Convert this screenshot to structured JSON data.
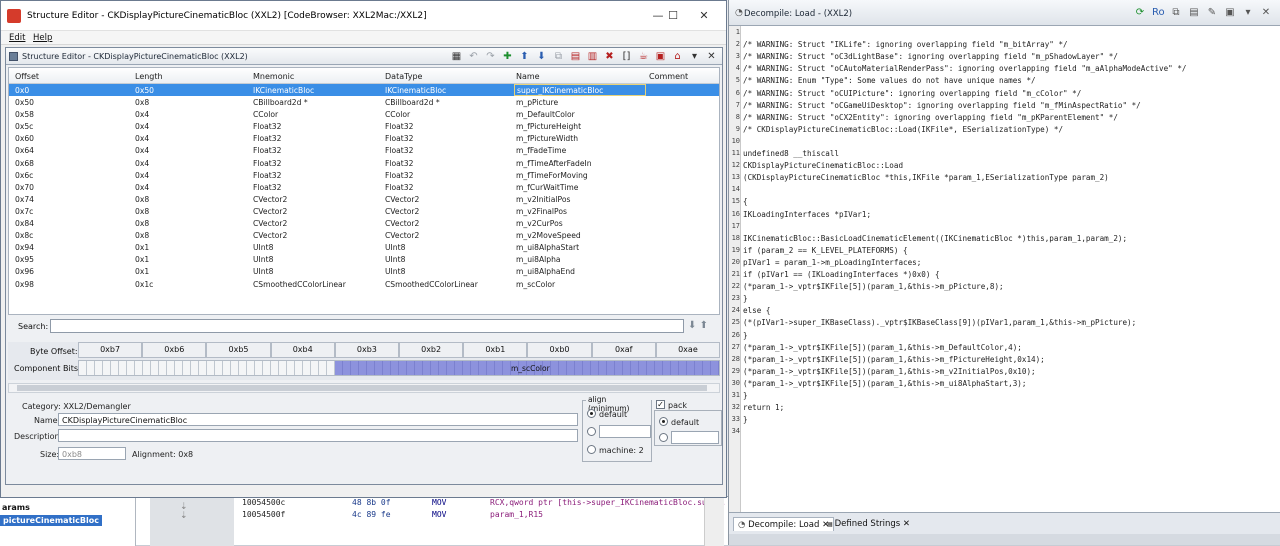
{
  "window": {
    "title": "Structure Editor - CKDisplayPictureCinematicBloc (XXL2) [CodeBrowser: XXL2Mac:/XXL2]",
    "minimize": "—",
    "maximize": "☐",
    "close": "✕"
  },
  "menu": [
    "Edit",
    "Help"
  ],
  "editor": {
    "title": "Structure Editor - CKDisplayPictureCinematicBloc (XXL2)",
    "columns": [
      "Offset",
      "Length",
      "Mnemonic",
      "DataType",
      "Name",
      "Comment"
    ],
    "rows": [
      [
        "0x0",
        "0x50",
        "IKCinematicBloc",
        "IKCinematicBloc",
        "super_IKCinematicBloc",
        ""
      ],
      [
        "0x50",
        "0x8",
        "CBillboard2d *",
        "CBillboard2d *",
        "m_pPicture",
        ""
      ],
      [
        "0x58",
        "0x4",
        "CColor",
        "CColor",
        "m_DefaultColor",
        ""
      ],
      [
        "0x5c",
        "0x4",
        "Float32",
        "Float32",
        "m_fPictureHeight",
        ""
      ],
      [
        "0x60",
        "0x4",
        "Float32",
        "Float32",
        "m_fPictureWidth",
        ""
      ],
      [
        "0x64",
        "0x4",
        "Float32",
        "Float32",
        "m_fFadeTime",
        ""
      ],
      [
        "0x68",
        "0x4",
        "Float32",
        "Float32",
        "m_fTimeAfterFadeIn",
        ""
      ],
      [
        "0x6c",
        "0x4",
        "Float32",
        "Float32",
        "m_fTimeForMoving",
        ""
      ],
      [
        "0x70",
        "0x4",
        "Float32",
        "Float32",
        "m_fCurWaitTime",
        ""
      ],
      [
        "0x74",
        "0x8",
        "CVector2",
        "CVector2",
        "m_v2InitialPos",
        ""
      ],
      [
        "0x7c",
        "0x8",
        "CVector2",
        "CVector2",
        "m_v2FinalPos",
        ""
      ],
      [
        "0x84",
        "0x8",
        "CVector2",
        "CVector2",
        "m_v2CurPos",
        ""
      ],
      [
        "0x8c",
        "0x8",
        "CVector2",
        "CVector2",
        "m_v2MoveSpeed",
        ""
      ],
      [
        "0x94",
        "0x1",
        "UInt8",
        "UInt8",
        "m_ui8AlphaStart",
        ""
      ],
      [
        "0x95",
        "0x1",
        "UInt8",
        "UInt8",
        "m_ui8Alpha",
        ""
      ],
      [
        "0x96",
        "0x1",
        "UInt8",
        "UInt8",
        "m_ui8AlphaEnd",
        ""
      ],
      [
        "0x98",
        "0x1c",
        "CSmoothedCColorLinear",
        "CSmoothedCColorLinear",
        "m_scColor",
        ""
      ]
    ],
    "search_label": "Search:",
    "byte_offset_label": "Byte Offset:",
    "component_bits_label": "Component Bits:",
    "bytes": [
      "0xb7",
      "0xb6",
      "0xb5",
      "0xb4",
      "0xb3",
      "0xb2",
      "0xb1",
      "0xb0",
      "0xaf",
      "0xae"
    ],
    "component_name": "m_scColor",
    "category": "Category:  XXL2/Demangler",
    "name_label": "Name:",
    "name_value": "CKDisplayPictureCinematicBloc",
    "description_label": "Description:",
    "size_label": "Size:",
    "size_value": "0xb8",
    "alignment": "Alignment:  0x8",
    "align_group": "align (minimum)",
    "align_default": "default",
    "align_machine": "machine: 2",
    "pack_label": "pack",
    "pack_default": "default"
  },
  "listing": {
    "left_title": "arams",
    "left_selected": "pictureCinematicBloc",
    "lines": [
      {
        "addr": "10054500c",
        "bytes": "48 8b 0f",
        "mn": "MOV",
        "op": "RCX,qword ptr [this->super_IKCinematicBloc.sup..."
      },
      {
        "addr": "10054500f",
        "bytes": "4c 89 fe",
        "mn": "MOV",
        "op": "param_1,R15"
      }
    ]
  },
  "decompile": {
    "title": "Decompile: Load -  (XXL2)",
    "lines": [
      "",
      "/* WARNING: Struct \"IKLife\": ignoring overlapping field \"m_bitArray\" */",
      "/* WARNING: Struct \"oC3dLightBase\": ignoring overlapping field \"m_pShadowLayer\" */",
      "/* WARNING: Struct \"oCAutoMaterialRenderPass\": ignoring overlapping field \"m_aAlphaModeActive\" */",
      "/* WARNING: Enum \"Type\": Some values do not have unique names */",
      "/* WARNING: Struct \"oCUIPicture\": ignoring overlapping field \"m_cColor\" */",
      "/* WARNING: Struct \"oCGameUiDesktop\": ignoring overlapping field \"m_fMinAspectRatio\" */",
      "/* WARNING: Struct \"oCX2Entity\": ignoring overlapping field \"m_pKParentElement\" */",
      "/* CKDisplayPictureCinematicBloc::Load(IKFile*, ESerializationType) */",
      "",
      "undefined8 __thiscall",
      "CKDisplayPictureCinematicBloc::Load",
      "          (CKDisplayPictureCinematicBloc *this,IKFile *param_1,ESerializationType param_2)",
      "",
      "{",
      "  IKLoadingInterfaces *pIVar1;",
      "",
      "  IKCinematicBloc::BasicLoadCinematicElement((IKCinematicBloc *)this,param_1,param_2);",
      "  if (param_2 == K_LEVEL_PLATEFORMS) {",
      "    pIVar1 = param_1->m_pLoadingInterfaces;",
      "    if (pIVar1 == (IKLoadingInterfaces *)0x0) {",
      "      (*param_1->_vptr$IKFile[5])(param_1,&this->m_pPicture,8);",
      "    }",
      "    else {",
      "      (*(pIVar1->super_IKBaseClass)._vptr$IKBaseClass[9])(pIVar1,param_1,&this->m_pPicture);",
      "    }",
      "    (*param_1->_vptr$IKFile[5])(param_1,&this->m_DefaultColor,4);",
      "    (*param_1->_vptr$IKFile[5])(param_1,&this->m_fPictureHeight,0x14);",
      "    (*param_1->_vptr$IKFile[5])(param_1,&this->m_v2InitialPos,0x10);",
      "    (*param_1->_vptr$IKFile[5])(param_1,&this->m_ui8AlphaStart,3);",
      "  }",
      "  return 1;",
      "}",
      ""
    ],
    "tabs": [
      "Decompile: Load",
      "Defined Strings"
    ],
    "tab_close": "✕"
  }
}
